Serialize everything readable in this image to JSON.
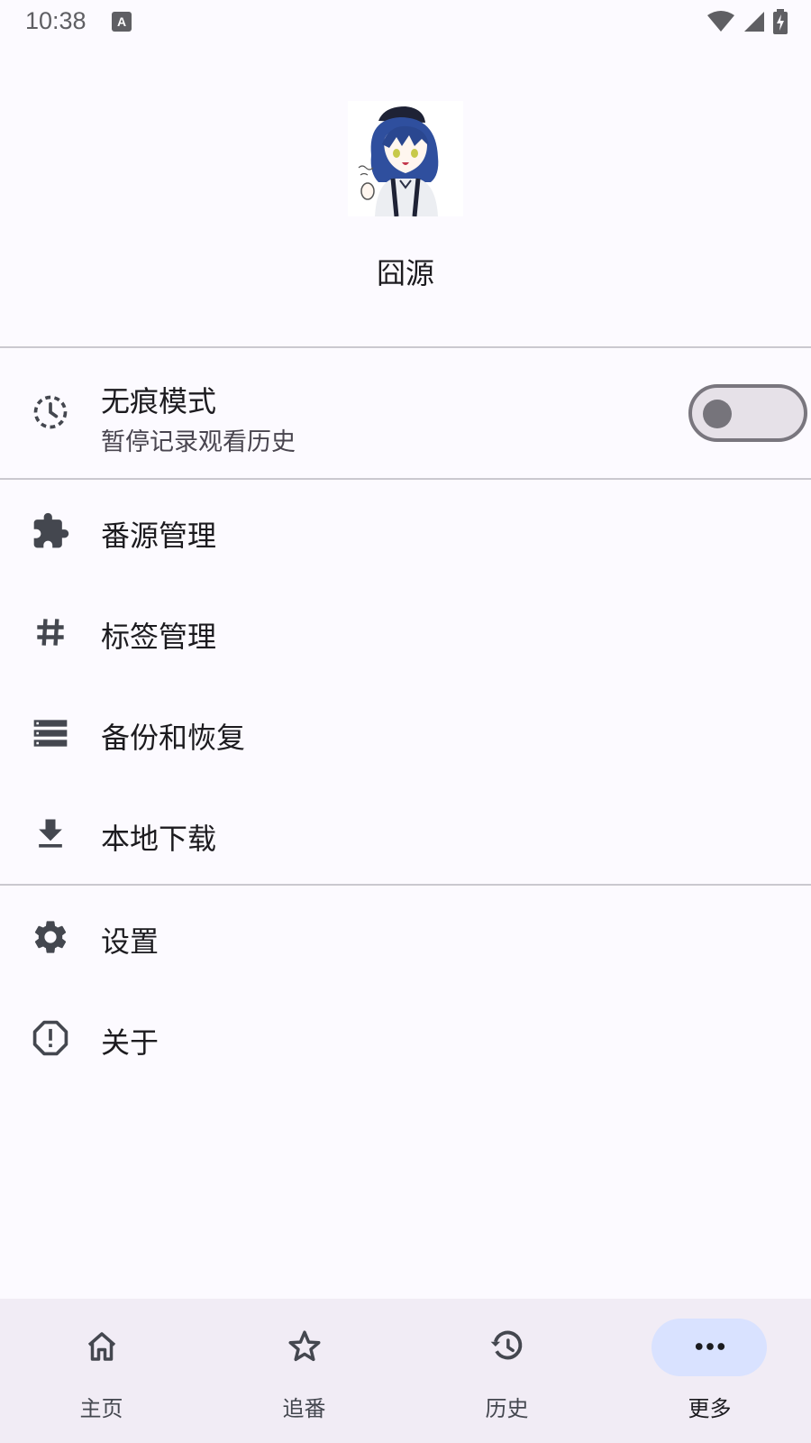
{
  "status_bar": {
    "time": "10:38",
    "icons": [
      "keyboard-a-icon",
      "wifi-icon",
      "signal-icon",
      "battery-charging-icon"
    ]
  },
  "header": {
    "app_name": "囧源",
    "avatar_icon": "anime-girl-avatar"
  },
  "incognito": {
    "title": "无痕模式",
    "subtitle": "暂停记录观看历史",
    "icon": "incognito-history-icon",
    "toggle_on": false
  },
  "menu": {
    "group1": [
      {
        "label": "番源管理",
        "icon": "extension-puzzle-icon"
      },
      {
        "label": "标签管理",
        "icon": "tag-hash-icon"
      },
      {
        "label": "备份和恢复",
        "icon": "storage-list-icon"
      },
      {
        "label": "本地下载",
        "icon": "download-icon"
      }
    ],
    "group2": [
      {
        "label": "设置",
        "icon": "settings-gear-icon"
      },
      {
        "label": "关于",
        "icon": "about-info-icon"
      }
    ]
  },
  "bottom_nav": {
    "items": [
      {
        "label": "主页",
        "icon": "home-icon",
        "active": false
      },
      {
        "label": "追番",
        "icon": "star-icon",
        "active": false
      },
      {
        "label": "历史",
        "icon": "history-icon",
        "active": false
      },
      {
        "label": "更多",
        "icon": "more-horiz-icon",
        "active": true
      }
    ]
  },
  "colors": {
    "background": "#fcfaff",
    "nav_background": "#f1ecf5",
    "active_indicator": "#d9e2ff",
    "icon": "#44474f"
  }
}
